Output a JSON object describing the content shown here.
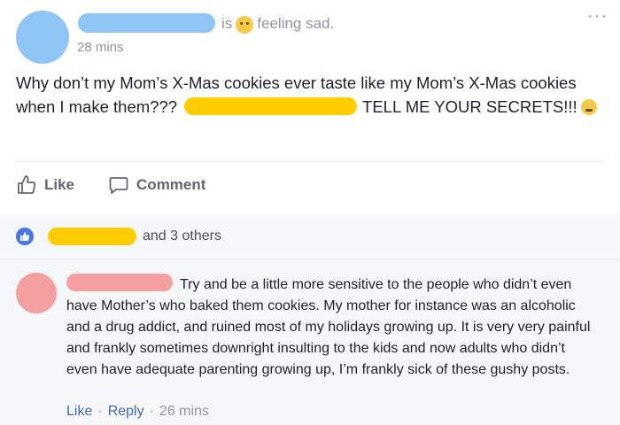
{
  "post": {
    "header": {
      "feeling_prefix": "is",
      "feeling_text": "feeling sad.",
      "timestamp": "28 mins",
      "more_glyph": "···"
    },
    "text": {
      "part1": "Why don’t my Mom’s X-Mas cookies ever taste like my Mom’s X-Mas cookies when I make them???",
      "part2": "TELL ME YOUR SECRETS!!!"
    },
    "actions": {
      "like_label": "Like",
      "comment_label": "Comment"
    },
    "reactions": {
      "others_text": "and 3 others"
    }
  },
  "comment": {
    "text": "Try and be a little more sensitive to the people who didn’t even have Mother’s who baked them cookies. My mother for instance was an alcoholic and a drug addict, and ruined most of my holidays growing up. It is very very painful and frankly sometimes downright insulting to the kids and now adults who didn’t even have adequate parenting growing up, I’m frankly sick of these gushy posts.",
    "like_label": "Like",
    "reply_label": "Reply",
    "timestamp": "26 mins",
    "separator": "·"
  },
  "colors": {
    "redact_blue": "#8ec5f5",
    "redact_yellow": "#ffcc00",
    "redact_pink": "#f4a0a0",
    "link_blue": "#4267b2",
    "reaction_blue": "#4a76e8"
  },
  "icons": {
    "feeling": "slightly-sad-face-emoji",
    "post_emoji": "tired-face-emoji",
    "like": "thumbs-up-outline-icon",
    "comment": "speech-bubble-icon",
    "reaction": "like-reaction-icon",
    "more": "more-options-icon"
  }
}
